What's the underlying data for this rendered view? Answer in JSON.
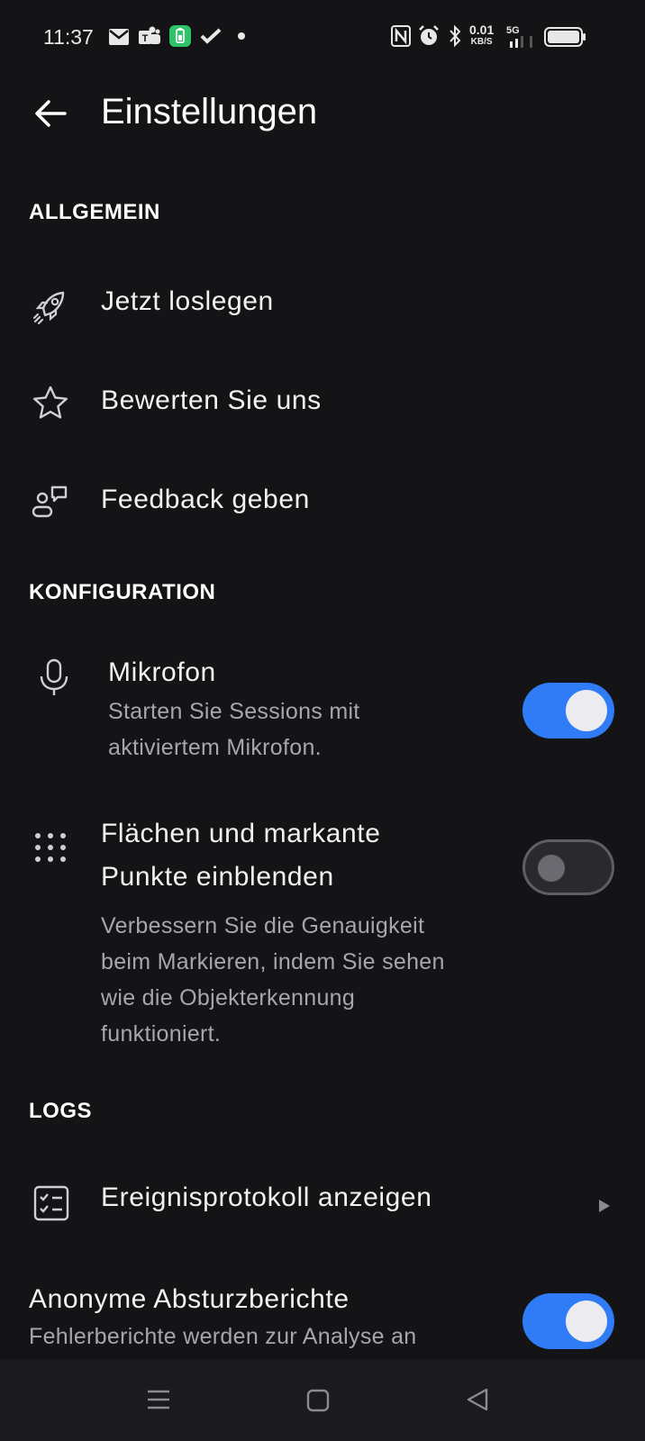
{
  "status_bar": {
    "time": "11:37",
    "speed_value": "0.01",
    "speed_unit": "KB/S",
    "network": "5G",
    "icons": [
      "gmail-icon",
      "teams-icon",
      "battery-app-icon",
      "check-icon",
      "dot-icon",
      "nfc-icon",
      "alarm-icon",
      "bluetooth-icon",
      "signal-icon",
      "battery-icon"
    ]
  },
  "app_bar": {
    "title": "Einstellungen",
    "back_icon": "arrow-left-icon"
  },
  "sections": {
    "general": "ALLGEMEIN",
    "config": "KONFIGURATION",
    "logs": "LOGS"
  },
  "general_items": [
    {
      "label": "Jetzt loslegen",
      "icon": "rocket-icon"
    },
    {
      "label": "Bewerten Sie uns",
      "icon": "star-icon"
    },
    {
      "label": "Feedback geben",
      "icon": "feedback-icon"
    }
  ],
  "config_items": [
    {
      "label": "Mikrofon",
      "description_lines": [
        "Starten Sie Sessions mit",
        "aktiviertem Mikrofon."
      ],
      "icon": "microphone-icon",
      "enabled": true
    },
    {
      "label_lines": [
        "Flächen und markante",
        "Punkte einblenden"
      ],
      "description_lines": [
        "Verbessern Sie die Genauigkeit",
        "beim Markieren, indem Sie sehen",
        "wie die Objekterkennung",
        "funktioniert."
      ],
      "icon": "dots-grid-icon",
      "enabled": false
    }
  ],
  "logs_items": [
    {
      "label": "Ereignisprotokoll anzeigen",
      "icon": "checklist-icon",
      "trailing_icon": "play-arrow-icon"
    },
    {
      "label": "Anonyme Absturzberichte",
      "description": "Fehlerberichte werden zur Analyse an",
      "enabled": true
    }
  ],
  "nav_bar": {
    "icons": [
      "menu-icon",
      "home-icon",
      "back-triangle-icon"
    ]
  },
  "colors": {
    "background": "#141417",
    "accent": "#2f7cf6",
    "secondary_text": "#a7a7ab"
  }
}
